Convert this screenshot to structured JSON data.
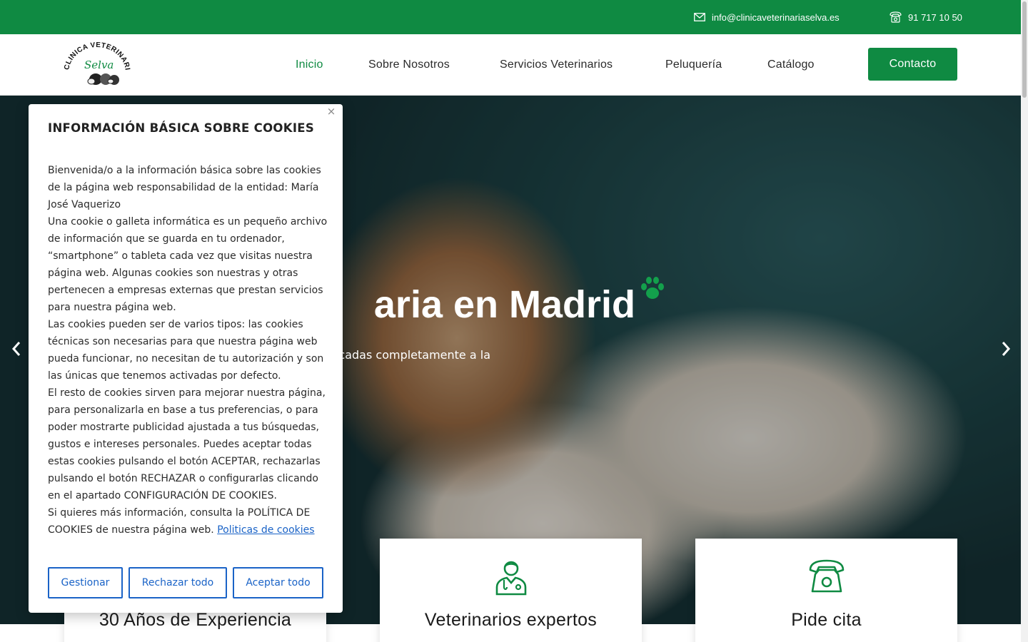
{
  "topbar": {
    "email": "info@clinicaveterinariaselva.es",
    "phone": "91 717 10 50"
  },
  "header": {
    "logo_text_top": "CLINICA VETERINARIA",
    "logo_text_script": "Selva",
    "nav": [
      {
        "label": "Inicio",
        "active": true
      },
      {
        "label": "Sobre Nosotros",
        "active": false
      },
      {
        "label": "Servicios Veterinarios",
        "active": false
      },
      {
        "label": "Peluquería",
        "active": false
      },
      {
        "label": "Catálogo",
        "active": false
      }
    ],
    "contact_button": "Contacto"
  },
  "hero": {
    "title": "aria en Madrid",
    "subtitle": "cadas completamente a la"
  },
  "cards": [
    {
      "title": "30 Años de Experiencia",
      "icon": "award-icon"
    },
    {
      "title": "Veterinarios expertos",
      "icon": "veterinarian-icon"
    },
    {
      "title": "Pide cita",
      "icon": "telephone-icon"
    }
  ],
  "cookie": {
    "title": "INFORMACIÓN BÁSICA SOBRE COOKIES",
    "paragraphs": [
      "Bienvenida/o a la información básica sobre las cookies de la página web responsabilidad de la entidad: María José Vaquerizo",
      "Una cookie o galleta informática es un pequeño archivo de información que se guarda en tu ordenador, “smartphone” o tableta cada vez que visitas nuestra página web. Algunas cookies son nuestras y otras pertenecen a empresas externas que prestan servicios para nuestra página web.",
      "Las cookies pueden ser de varios tipos: las cookies técnicas son necesarias para que nuestra página web pueda funcionar, no necesitan de tu autorización y son las únicas que tenemos activadas por defecto.",
      "El resto de cookies sirven para mejorar nuestra página, para personalizarla en base a tus preferencias, o para poder mostrarte publicidad ajustada a tus búsquedas, gustos e intereses personales. Puedes aceptar todas estas cookies pulsando el botón ACEPTAR, rechazarlas pulsando el botón RECHAZAR o configurarlas clicando en el apartado CONFIGURACIÓN DE COOKIES.",
      "Si quieres más información, consulta la POLÍTICA DE COOKIES de nuestra página web."
    ],
    "policy_link": "Politicas de cookies",
    "buttons": {
      "manage": "Gestionar",
      "reject": "Rechazar todo",
      "accept": "Aceptar todo"
    }
  },
  "colors": {
    "brand_green": "#0f8a42",
    "link_blue": "#1a63c7"
  }
}
